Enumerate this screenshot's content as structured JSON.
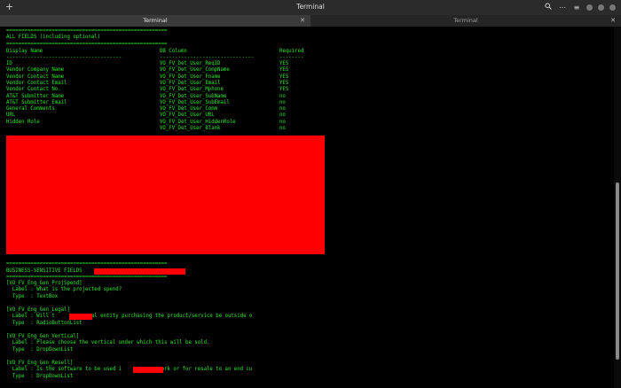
{
  "window": {
    "title": "Terminal",
    "new_tab_icon": "plus-icon",
    "search_icon": "search-icon",
    "menu_icon": "more-icon",
    "tabs": [
      {
        "label": "Terminal",
        "active": true
      },
      {
        "label": "Terminal",
        "active": false
      }
    ]
  },
  "terminal": {
    "sep": "=====================================================",
    "all_fields_title": "ALL FIELDS (including optional)",
    "headers": {
      "display": "Display Name",
      "db": "DB Column",
      "req": "Required"
    },
    "dashes": {
      "display": "--------------------------------------",
      "db": "-------------------------------",
      "req": "--------"
    },
    "rows": [
      {
        "display": "ID",
        "db": "VO_FV_Det_User_ReqID",
        "req": "YES"
      },
      {
        "display": "Vendor Company Name",
        "db": "VO_FV_Det_User_CompName",
        "req": "YES"
      },
      {
        "display": "Vendor Contact Name",
        "db": "VO_FV_Det_User_Fname",
        "req": "YES"
      },
      {
        "display": "Vendor Contact Email",
        "db": "VO_FV_Det_User_Email",
        "req": "YES"
      },
      {
        "display": "Vendor Contact No.",
        "db": "VO_FV_Det_User_Mphone",
        "req": "YES"
      },
      {
        "display": "AT&T Submitter Name",
        "db": "VO_FV_Det_User_SubName",
        "req": "no"
      },
      {
        "display": "AT&T Submitter Email",
        "db": "VO_FV_Det_User_SubEmail",
        "req": "no"
      },
      {
        "display": "General Comments",
        "db": "VO_FV_Det_User_Comm",
        "req": "no"
      },
      {
        "display": "URL",
        "db": "VO_FV_Det_User_URL",
        "req": "no"
      },
      {
        "display": "Hidden Role",
        "db": "VO_FV_Det_User_HiddenRole",
        "req": "no"
      },
      {
        "display": "",
        "db": "VO_FV_Det_User_Blank",
        "req": "no"
      }
    ],
    "business_title": "BUSINESS-SENSITIVE FIELDS",
    "fields": [
      {
        "id": "[VO_FV_Eng_Gen_ProjSpend]",
        "label": "  Label : What is the projected spend?",
        "type": "  Type  : TextBox"
      },
      {
        "id": "[VO_FV_Eng_Gen_Legal]",
        "label": "  Label : Will t          egal entity purchasing the product/service be outside o",
        "type": "  Type  : RadioButtonList"
      },
      {
        "id": "[VO_FV_Eng_Gen_Vertical]",
        "label": "  Label : Please choose the vertical under which this will be sold.",
        "type": "  Type  : DropDownList"
      },
      {
        "id": "[VO_FV_Eng_Gen_Resell]",
        "label": "  Label : Is the software to be used i          etwork or for resale to an end cu",
        "type": "  Type  : DropDownList"
      }
    ]
  }
}
